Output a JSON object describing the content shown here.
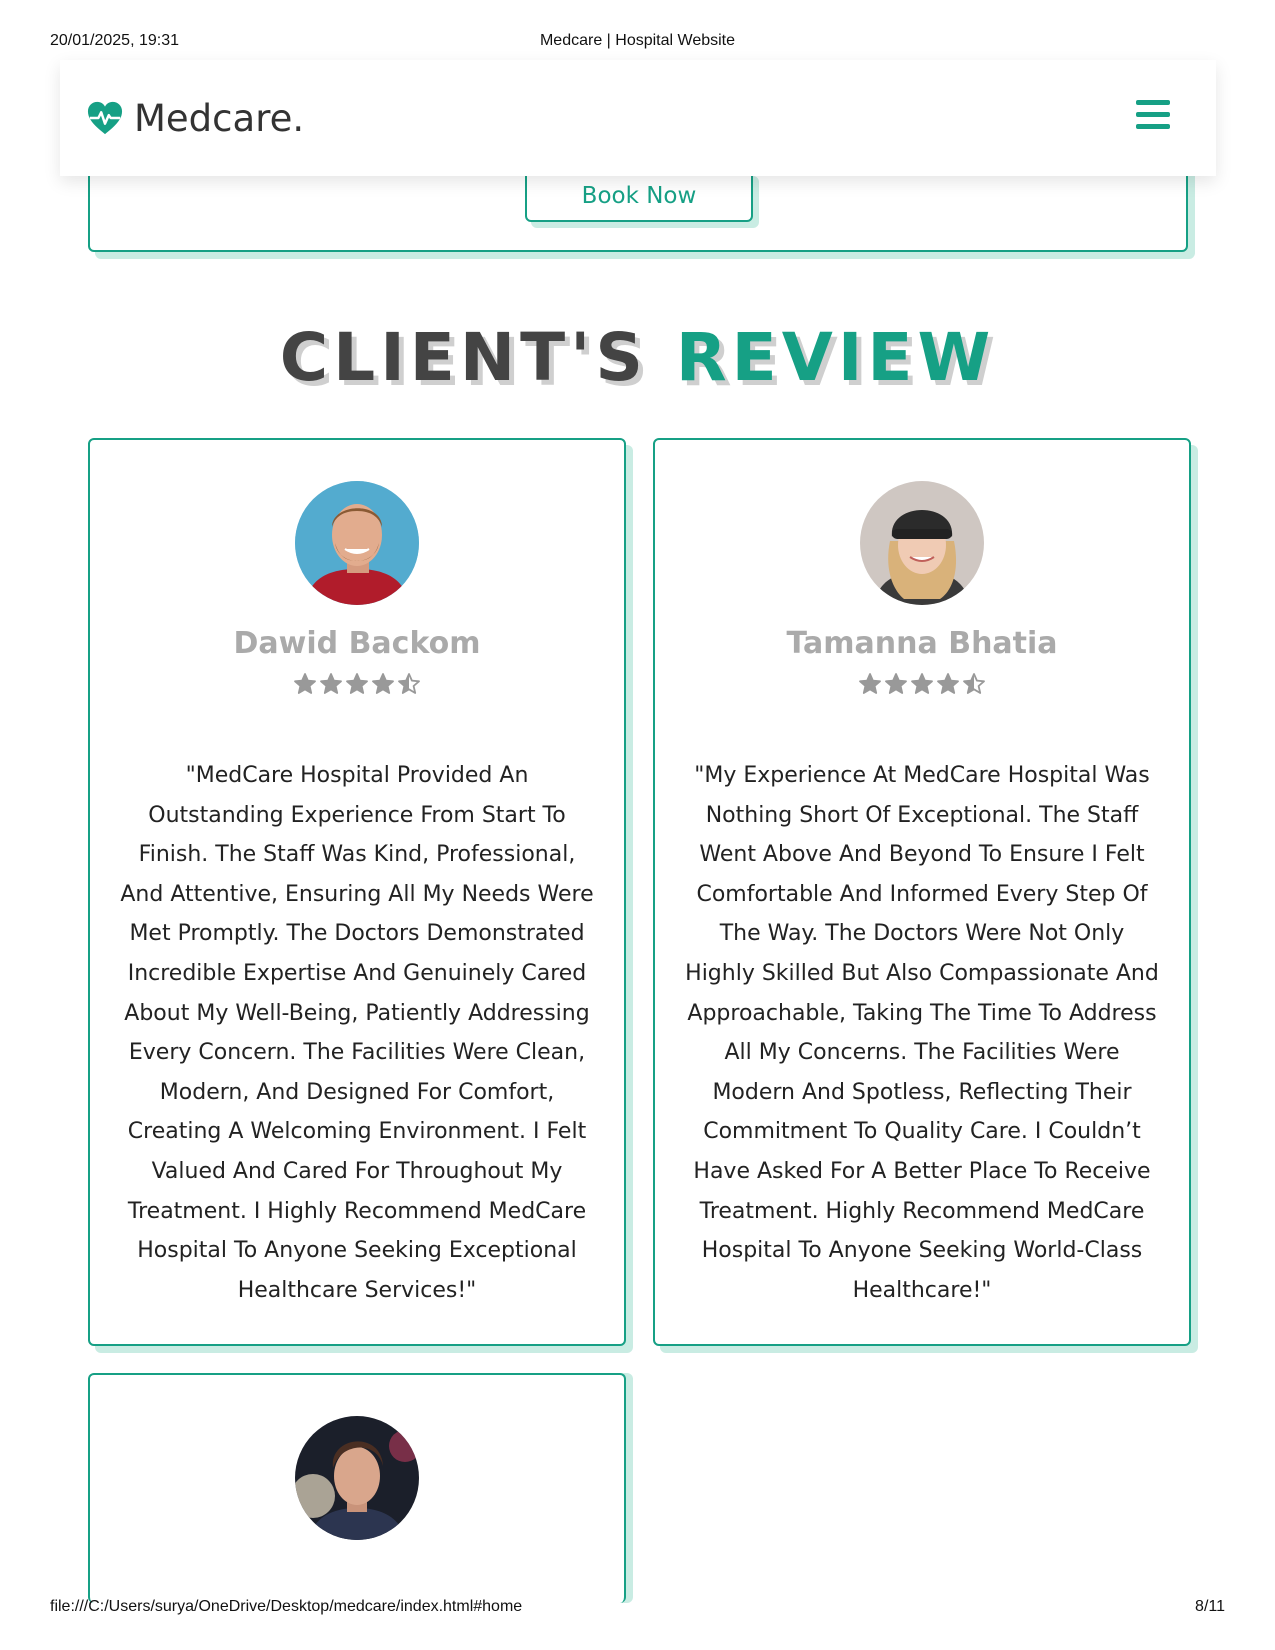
{
  "print": {
    "datetime": "20/01/2025, 19:31",
    "title": "Medcare | Hospital Website",
    "url": "file:///C:/Users/surya/OneDrive/Desktop/medcare/index.html#home",
    "page": "8/11"
  },
  "header": {
    "logo_text": "Medcare.",
    "logo_icon": "heartbeat-icon",
    "menu_icon": "hamburger-menu-icon"
  },
  "previous_section": {
    "book_button": "Book Now"
  },
  "section": {
    "title_part1": "CLIENT'S",
    "title_part2": "REVIEW"
  },
  "reviews": [
    {
      "name": "Dawid Backom",
      "rating": 4.5,
      "text": "\"MedCare Hospital Provided An Outstanding Experience From Start To Finish. The Staff Was Kind, Professional, And Attentive, Ensuring All My Needs Were Met Promptly. The Doctors Demonstrated Incredible Expertise And Genuinely Cared About My Well-Being, Patiently Addressing Every Concern. The Facilities Were Clean, Modern, And Designed For Comfort, Creating A Welcoming Environment. I Felt Valued And Cared For Throughout My Treatment. I Highly Recommend MedCare Hospital To Anyone Seeking Exceptional Healthcare Services!\""
    },
    {
      "name": "Tamanna Bhatia",
      "rating": 4.5,
      "text": "\"My Experience At MedCare Hospital Was Nothing Short Of Exceptional. The Staff Went Above And Beyond To Ensure I Felt Comfortable And Informed Every Step Of The Way. The Doctors Were Not Only Highly Skilled But Also Compassionate And Approachable, Taking The Time To Address All My Concerns. The Facilities Were Modern And Spotless, Reflecting Their Commitment To Quality Care. I Couldn’t Have Asked For A Better Place To Receive Treatment. Highly Recommend MedCare Hospital To Anyone Seeking World-Class Healthcare!\""
    }
  ],
  "colors": {
    "accent": "#16a085",
    "accent_shadow": "#c9ece3",
    "heading_dark": "#444444",
    "name_gray": "#aaaaaa"
  }
}
